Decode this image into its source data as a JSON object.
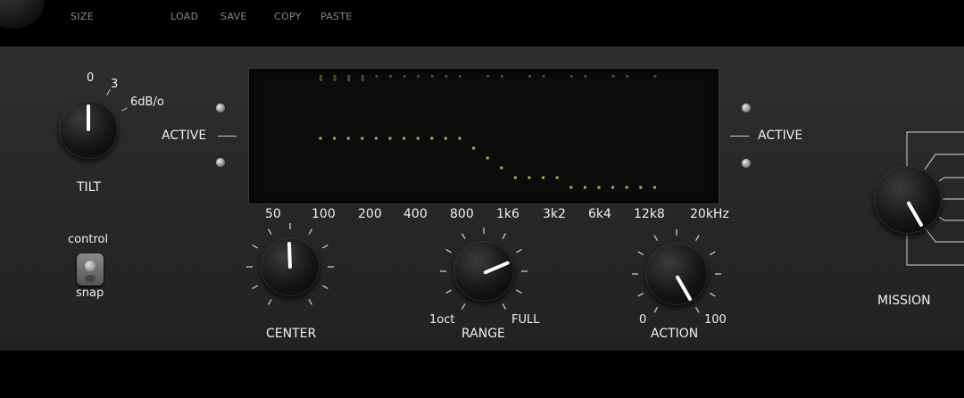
{
  "menu": {
    "size": "SIZE",
    "load": "LOAD",
    "save": "SAVE",
    "copy": "COPY",
    "paste": "PASTE"
  },
  "tilt": {
    "label": "TILT",
    "scale_0": "0",
    "scale_3": "3",
    "scale_6": "6dB/o"
  },
  "active_left": "ACTIVE",
  "active_right": "ACTIVE",
  "freq_labels": [
    "50",
    "100",
    "200",
    "400",
    "800",
    "1k6",
    "3k2",
    "6k4",
    "12k8",
    "20kHz"
  ],
  "switch": {
    "top_label": "control",
    "bottom_label": "snap"
  },
  "center": {
    "label": "CENTER"
  },
  "range": {
    "label": "RANGE",
    "min_label": "1oct",
    "max_label": "FULL"
  },
  "action": {
    "label": "ACTION",
    "min_label": "0",
    "max_label": "100"
  },
  "mission": {
    "label": "MISSION"
  },
  "colors": {
    "panel": "#2a2a2a",
    "led_dots": "#a9b04a",
    "text": "#f0f0f0",
    "menu_text": "#8a8a8a"
  },
  "chart_data": {
    "type": "line",
    "series": [
      {
        "values": [
          0,
          0,
          0,
          0,
          0,
          0,
          0,
          0,
          0,
          0,
          0,
          -1,
          -2,
          -3,
          -4,
          -4,
          -4,
          -4,
          -5,
          -5,
          -5,
          -5,
          -5,
          -5,
          -5
        ]
      }
    ]
  }
}
